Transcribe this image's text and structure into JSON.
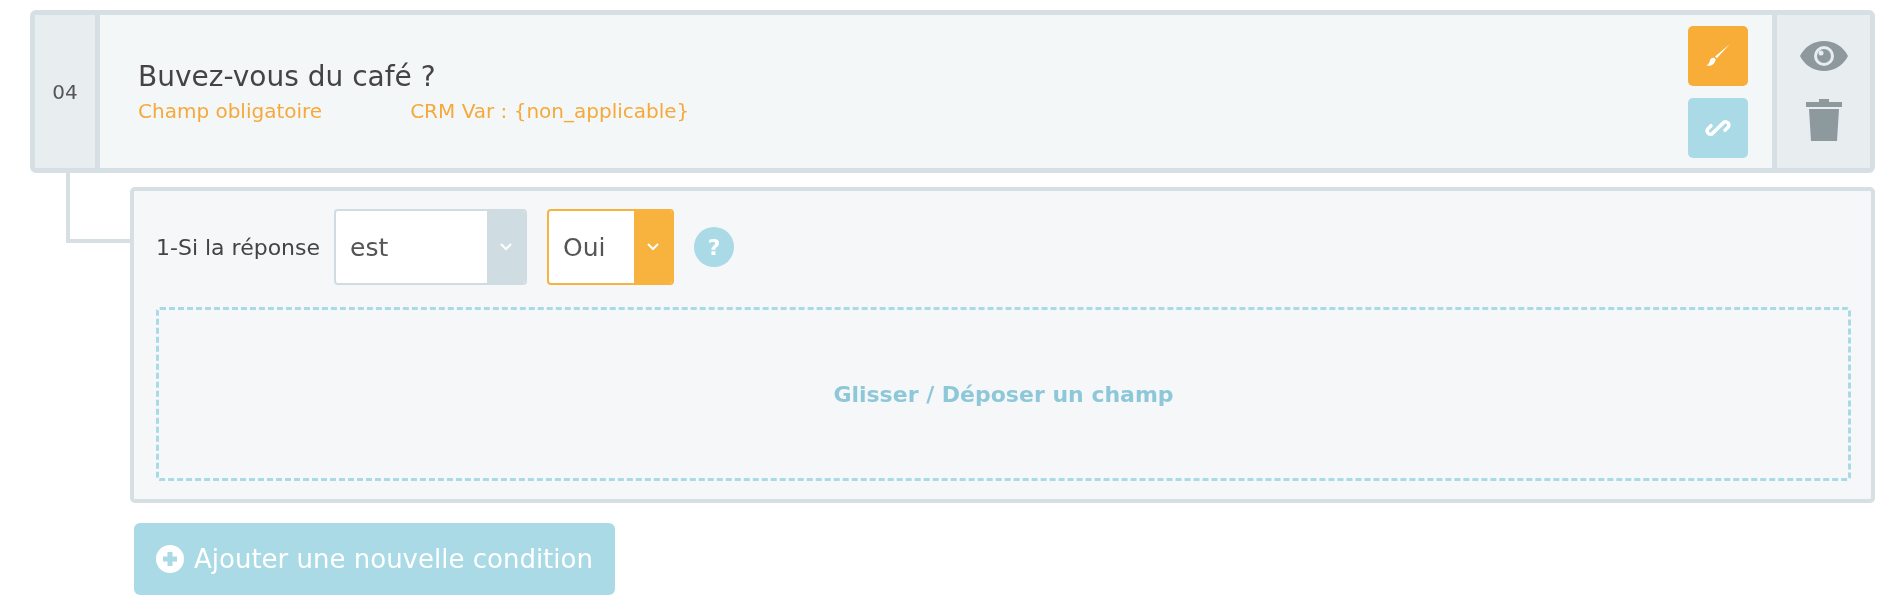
{
  "question": {
    "number": "04",
    "title": "Buvez-vous du café ?",
    "required_label": "Champ obligatoire",
    "crm_var": "CRM Var : {non_applicable}"
  },
  "conditions": [
    {
      "label": "1-Si la réponse",
      "operator": "est",
      "value": "Oui",
      "help": "?",
      "dropzone": "Glisser / Déposer un champ"
    }
  ],
  "add_button": "Ajouter une nouvelle condition"
}
